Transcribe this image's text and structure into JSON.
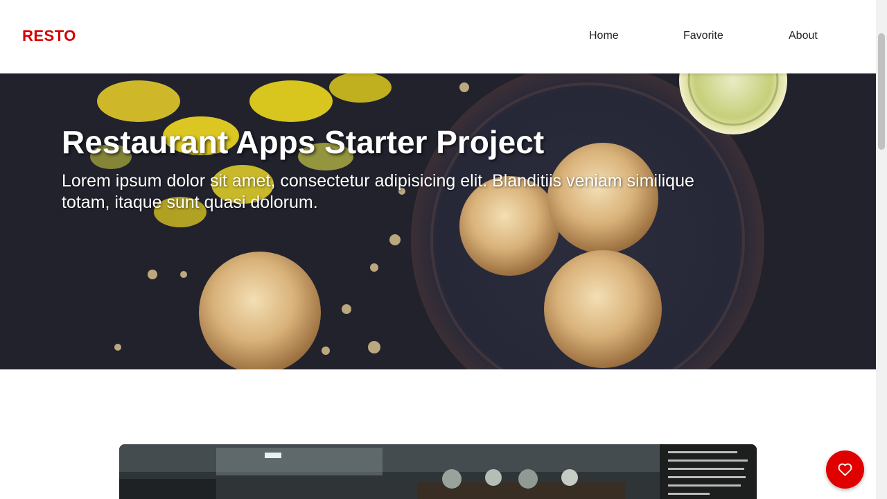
{
  "header": {
    "brand": "RESTO",
    "nav": [
      {
        "label": "Home"
      },
      {
        "label": "Favorite"
      },
      {
        "label": "About"
      }
    ]
  },
  "hero": {
    "title": "Restaurant Apps Starter Project",
    "tagline": "Lorem ipsum dolor sit amet, consectetur adipisicing elit. Blanditiis veniam similique totam, itaque sunt quasi dolorum."
  },
  "fab": {
    "icon": "heart-icon"
  },
  "colors": {
    "brand": "#d60000",
    "fab": "#e00000",
    "hero_bg": "#24252f"
  }
}
